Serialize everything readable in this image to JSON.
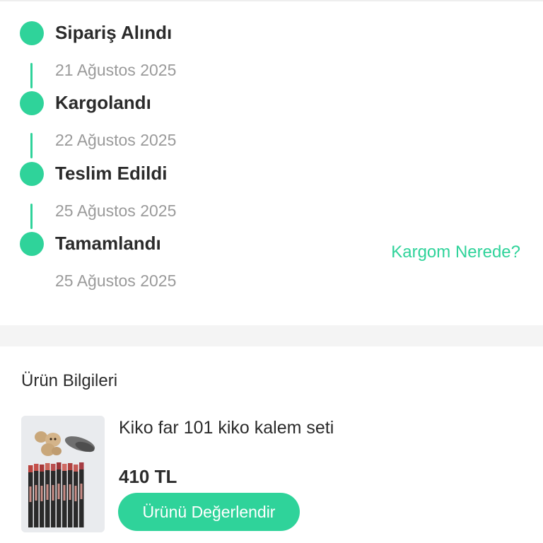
{
  "order_status": {
    "steps": [
      {
        "title": "Sipariş Alındı",
        "date": "21 Ağustos 2025"
      },
      {
        "title": "Kargolandı",
        "date": "22 Ağustos 2025"
      },
      {
        "title": "Teslim Edildi",
        "date": "25 Ağustos 2025"
      },
      {
        "title": "Tamamlandı",
        "date": "25 Ağustos 2025"
      }
    ],
    "track_link_label": "Kargom Nerede?",
    "accent_color": "#2fd39a"
  },
  "product_section": {
    "title": "Ürün Bilgileri",
    "product": {
      "name": "Kiko far 101 kiko kalem seti",
      "price": "410 TL",
      "image_icon": "product-photo-lip-liner-set"
    },
    "review_button_label": "Ürünü Değerlendir"
  }
}
